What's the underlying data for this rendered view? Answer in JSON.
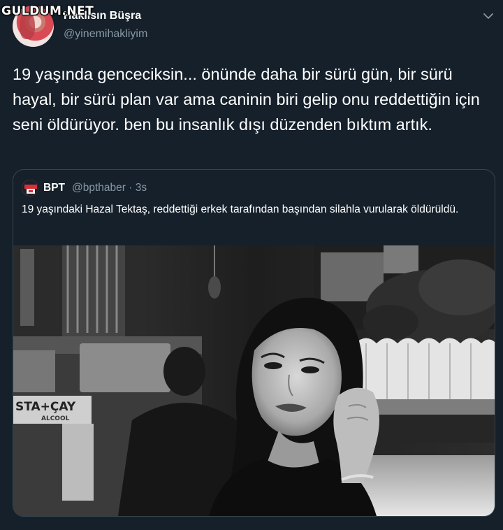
{
  "watermark": "GULDUM.NET",
  "tweet": {
    "display_name": "Haklısın Büşra",
    "handle": "@yinemihakliyim",
    "text": "19 yaşında genceciksin... önünde daha bir sürü gün, bir sürü hayal, bir sürü plan var ama caninin biri gelip onu reddettiğin için seni öldürüyor. ben bu insanlık dışı düzenden bıktım artık."
  },
  "quoted_tweet": {
    "display_name": "BPT",
    "handle_time": "@bpthaber · 3s",
    "text": "19 yaşındaki Hazal Tektaş, reddettiği erkek tarafından başından silahla vurularak öldürüldü.",
    "image": {
      "sign_text": "STA+ÇAY",
      "sign_subtext": "ALCOOL"
    }
  },
  "icons": {
    "more": "chevron-down-icon",
    "quote_avatar": "bpt-logo-icon"
  },
  "colors": {
    "background": "#15202b",
    "text_primary": "#ffffff",
    "text_secondary": "#8899a6",
    "border": "#38444d"
  }
}
